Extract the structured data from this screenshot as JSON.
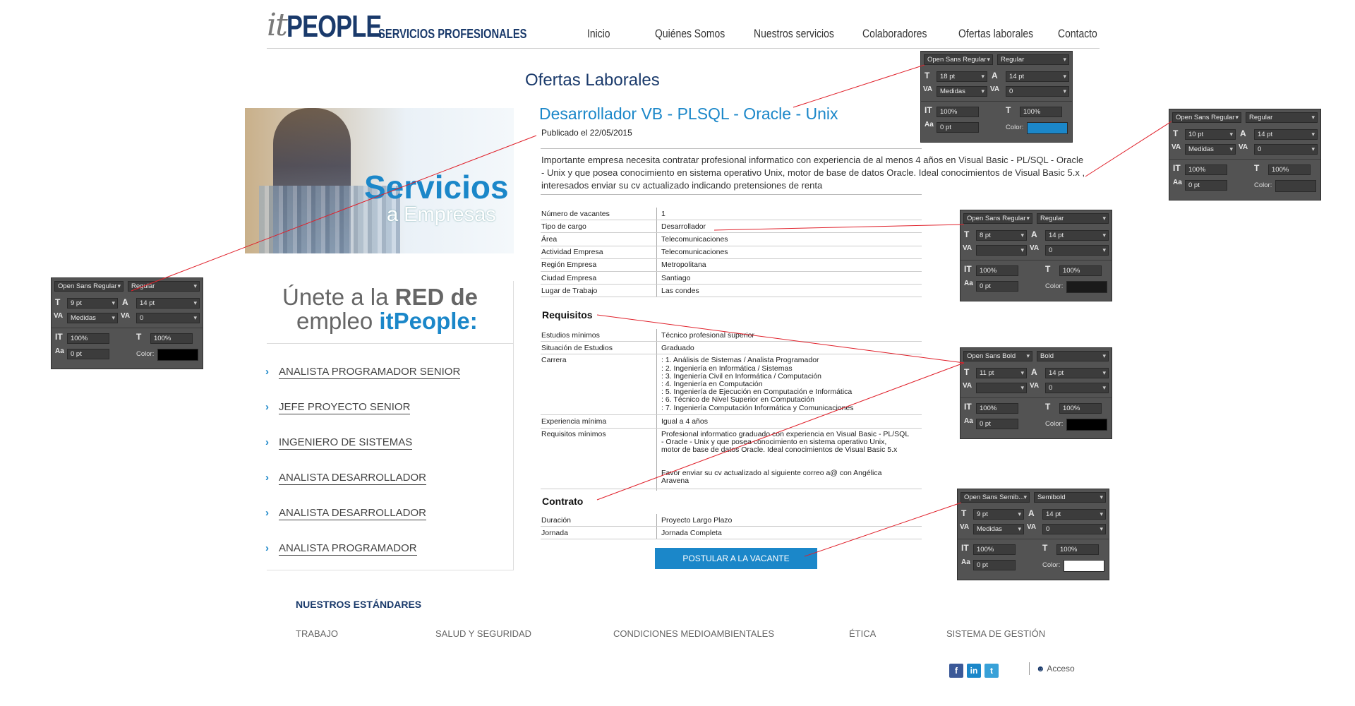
{
  "header": {
    "logo_it": "it",
    "logo_people": "PEOPLE",
    "logo_sub": "SERVICIOS PROFESIONALES",
    "nav": [
      "Inicio",
      "Quiénes Somos",
      "Nuestros servicios",
      "Colaboradores",
      "Ofertas laborales",
      "Contacto"
    ],
    "active_nav": "Ofertas laborales"
  },
  "page_title": "Ofertas Laborales",
  "sidebar": {
    "hero_line1": "Servicios",
    "hero_line2": "a Empresas",
    "join_line1_a": "Únete a la",
    "join_line1_b": "RED de",
    "join_line2_a": "empleo",
    "join_line2_b": "itPeople:",
    "jobs": [
      "ANALISTA PROGRAMADOR SENIOR",
      "JEFE PROYECTO SENIOR",
      "INGENIERO DE SISTEMAS",
      "ANALISTA DESARROLLADOR",
      "ANALISTA DESARROLLADOR",
      "ANALISTA PROGRAMADOR"
    ]
  },
  "offer": {
    "title": "Desarrollador VB - PLSQL - Oracle - Unix",
    "published": "Publicado el 22/05/2015",
    "description": "Importante empresa necesita contratar profesional informatico con experiencia de al menos 4 años en Visual Basic - PL/SQL - Oracle - Unix y que posea conocimiento en sistema operativo Unix, motor de base de datos Oracle. Ideal conocimientos de Visual Basic 5.x , interesados enviar su cv actualizado indicando pretensiones de renta",
    "details": [
      {
        "k": "Número de vacantes",
        "v": "1"
      },
      {
        "k": "Tipo de cargo",
        "v": "Desarrollador"
      },
      {
        "k": "Área",
        "v": "Telecomunicaciones"
      },
      {
        "k": "Actividad Empresa",
        "v": "Telecomunicaciones"
      },
      {
        "k": "Región Empresa",
        "v": "Metropolitana"
      },
      {
        "k": "Ciudad Empresa",
        "v": "Santiago"
      },
      {
        "k": "Lugar de Trabajo",
        "v": "Las condes"
      }
    ],
    "requisitos_title": "Requisitos",
    "requisitos": {
      "estudios_k": "Estudios mínimos",
      "estudios_v": "Técnico profesional superior",
      "situacion_k": "Situación de Estudios",
      "situacion_v": "Graduado",
      "carrera_k": "Carrera",
      "carreras": [
        ": 1. Análisis de Sistemas / Analista Programador",
        ": 2. Ingeniería en Informática / Sistemas",
        ": 3. Ingeniería Civil en Informática / Computación",
        ": 4. Ingeniería en Computación",
        ": 5. Ingeniería de Ejecución en Computación e Informática",
        ": 6. Técnico de Nivel Superior en Computación",
        ": 7. Ingeniería Computación Informática y Comunicaciones"
      ],
      "experiencia_k": "Experiencia mínima",
      "experiencia_v": "Igual a 4 años",
      "req_min_k": "Requisitos mínimos",
      "req_min_lines": [
        "Profesional informatico graduado con experiencia en Visual Basic - PL/SQL",
        "- Oracle - Unix y que posea conocimiento en sistema operativo Unix,",
        "motor de base de datos Oracle. Ideal conocimientos de Visual Basic 5.x",
        "",
        "",
        "Favor enviar su cv actualizado al siguiente correo a@ con Angélica",
        "Aravena"
      ]
    },
    "contrato_title": "Contrato",
    "contrato": [
      {
        "k": "Duración",
        "v": "Proyecto Largo Plazo"
      },
      {
        "k": "Jornada",
        "v": "Jornada Completa"
      }
    ],
    "apply_button": "POSTULAR A LA VACANTE"
  },
  "footer": {
    "title": "NUESTROS ESTÁNDARES",
    "items": [
      "TRABAJO",
      "SALUD Y SEGURIDAD",
      "CONDICIONES MEDIOAMBIENTALES",
      "ÉTICA",
      "SISTEMA DE GESTIÓN"
    ],
    "social": [
      "f",
      "in",
      "t"
    ],
    "access": "Acceso"
  },
  "ps_panels": [
    {
      "font": "Open Sans Regular",
      "style": "Regular",
      "size": "18 pt",
      "leading": "14 pt",
      "kern": "Medidas",
      "track": "0",
      "vscale": "100%",
      "hscale": "100%",
      "baseline": "0 pt",
      "color_label": "Color:",
      "color": "#1b87c9"
    },
    {
      "font": "Open Sans Regular",
      "style": "Regular",
      "size": "10 pt",
      "leading": "14 pt",
      "kern": "Medidas",
      "track": "0",
      "vscale": "100%",
      "hscale": "100%",
      "baseline": "0 pt",
      "color_label": "Color:",
      "color": "#3c3c3c"
    },
    {
      "font": "Open Sans Regular",
      "style": "Regular",
      "size": "8 pt",
      "leading": "14 pt",
      "kern": "",
      "track": "0",
      "vscale": "100%",
      "hscale": "100%",
      "baseline": "0 pt",
      "color_label": "Color:",
      "color": "#1a1a1a"
    },
    {
      "font": "Open Sans Regular",
      "style": "Regular",
      "size": "9 pt",
      "leading": "14 pt",
      "kern": "Medidas",
      "track": "0",
      "vscale": "100%",
      "hscale": "100%",
      "baseline": "0 pt",
      "color_label": "Color:",
      "color": "#000000"
    },
    {
      "font": "Open Sans Bold",
      "style": "Bold",
      "size": "11 pt",
      "leading": "14 pt",
      "kern": "",
      "track": "0",
      "vscale": "100%",
      "hscale": "100%",
      "baseline": "0 pt",
      "color_label": "Color:",
      "color": "#000000"
    },
    {
      "font": "Open Sans Semib...",
      "style": "Semibold",
      "size": "9 pt",
      "leading": "14 pt",
      "kern": "Medidas",
      "track": "0",
      "vscale": "100%",
      "hscale": "100%",
      "baseline": "0 pt",
      "color_label": "Color:",
      "color": "#ffffff"
    }
  ],
  "colors": {
    "brand_blue": "#1b87c9",
    "navy": "#1a3a6b",
    "annotation_line": "#e0202a"
  }
}
